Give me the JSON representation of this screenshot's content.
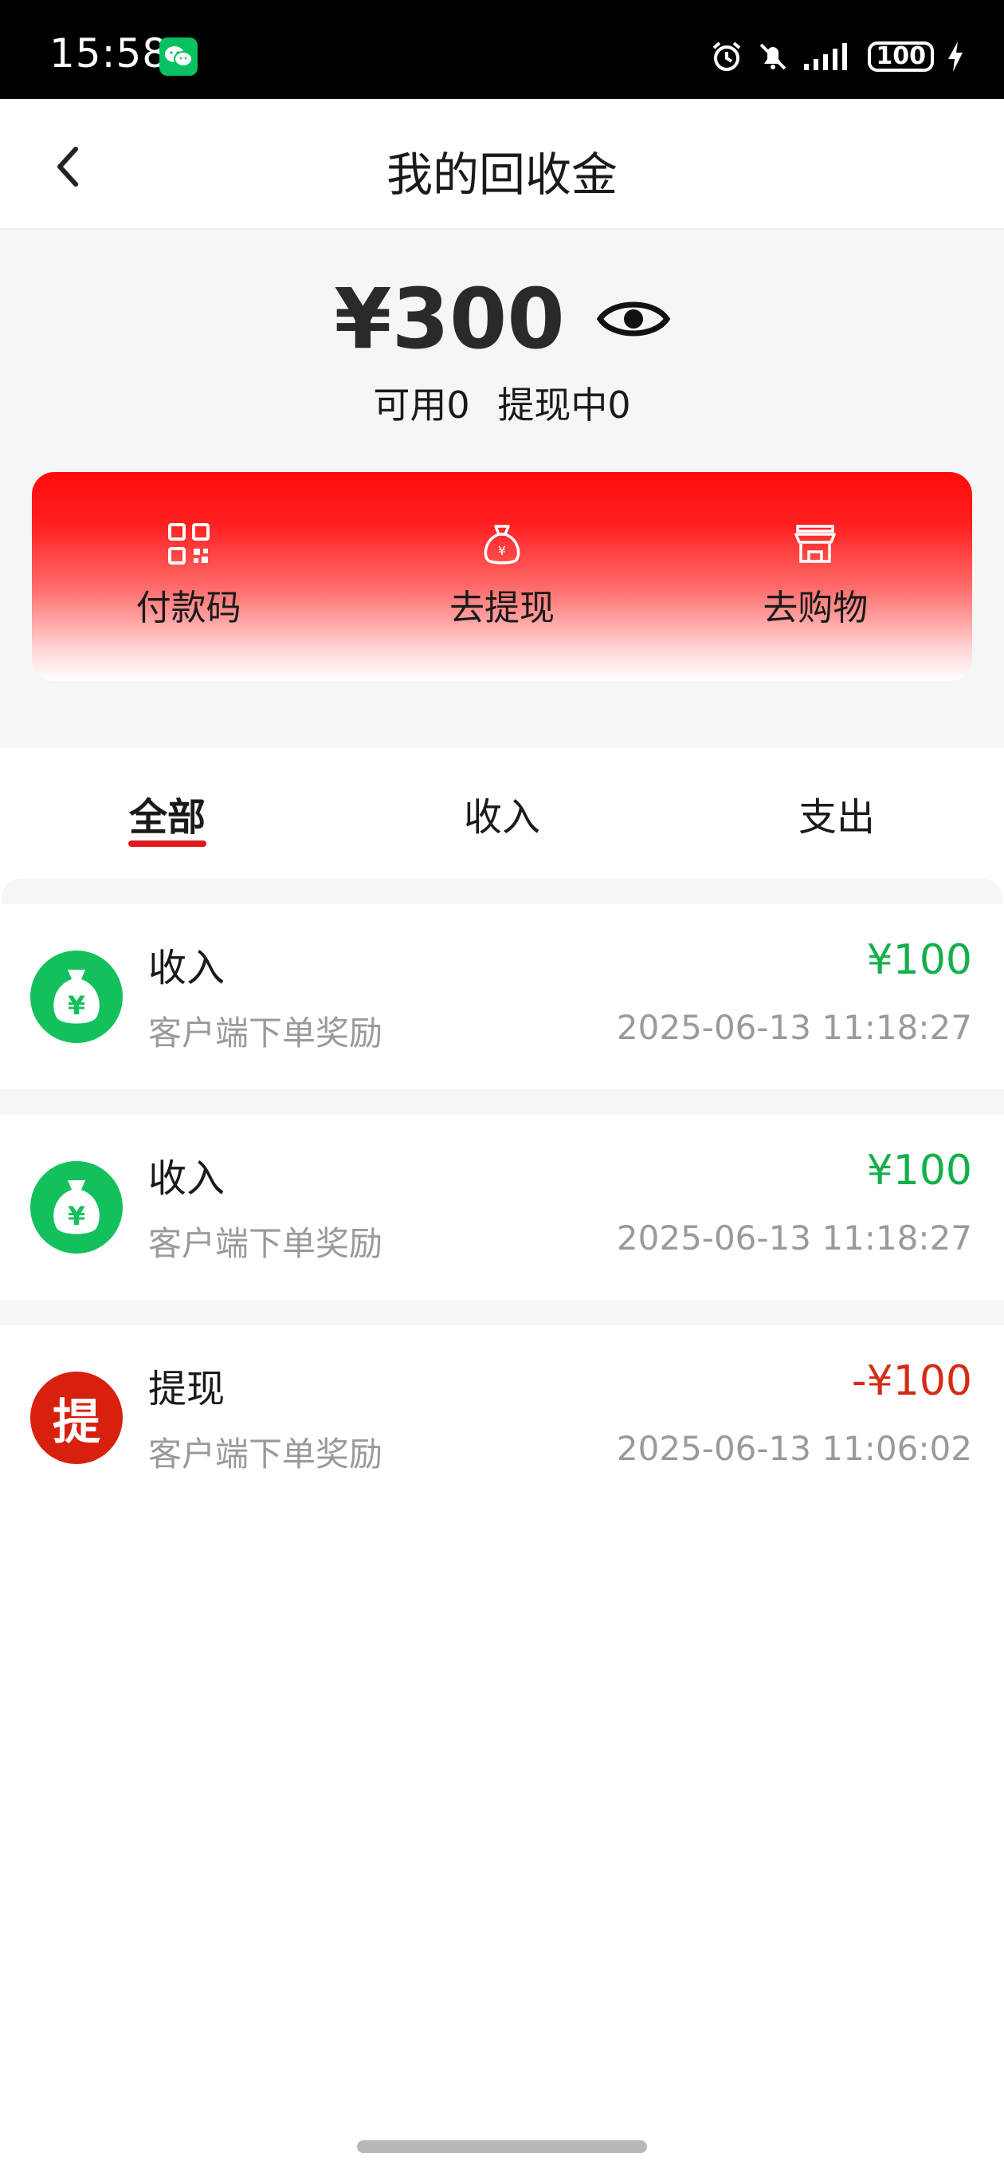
{
  "status_bar": {
    "time": "15:58",
    "battery": "100",
    "icons": [
      "wechat-icon",
      "alarm-icon",
      "bell-off-icon",
      "signal-icon",
      "battery-icon",
      "charging-icon"
    ]
  },
  "header": {
    "title": "我的回收金",
    "back_icon": "chevron-left-icon"
  },
  "summary": {
    "balance": "¥300",
    "available": "可用0",
    "withdrawing": "提现中0"
  },
  "actions": [
    {
      "label": "付款码",
      "icon": "qrcode-icon"
    },
    {
      "label": "去提现",
      "icon": "money-bag-icon"
    },
    {
      "label": "去购物",
      "icon": "store-icon"
    }
  ],
  "tabs": [
    {
      "label": "全部",
      "active": true
    },
    {
      "label": "收入",
      "active": false
    },
    {
      "label": "支出",
      "active": false
    }
  ],
  "transactions": [
    {
      "title": "收入",
      "desc": "客户端下单奖励",
      "amount": "¥100",
      "time": "2025-06-13 11:18:27",
      "type": "income"
    },
    {
      "title": "收入",
      "desc": "客户端下单奖励",
      "amount": "¥100",
      "time": "2025-06-13 11:18:27",
      "type": "income"
    },
    {
      "title": "提现",
      "desc": "客户端下单奖励",
      "amount": "-¥100",
      "time": "2025-06-13 11:06:02",
      "type": "withdraw",
      "icon_text": "提"
    }
  ],
  "colors": {
    "accent_red": "#e0191e",
    "income_green": "#12b04a",
    "withdraw_red": "#d42c14"
  }
}
